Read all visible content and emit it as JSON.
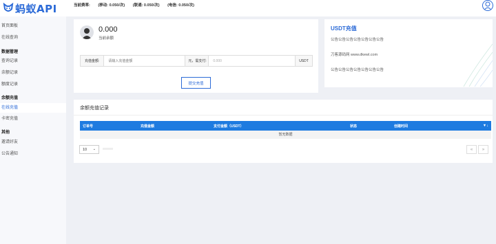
{
  "app": {
    "logo_text": "蚂蚁API"
  },
  "header": {
    "rates_label": "当前费率:",
    "rate_mobile": "(移动: 0.050/次)",
    "rate_unicom": "(联通: 0.050/次)",
    "rate_telecom": "(电信: 0.050/次)"
  },
  "sidebar": {
    "items": [
      {
        "label": "首页面板",
        "kind": "item"
      },
      {
        "label": "在线查询",
        "kind": "item"
      },
      {
        "label": "数据管理",
        "kind": "section"
      },
      {
        "label": "查询记录",
        "kind": "item"
      },
      {
        "label": "余额记录",
        "kind": "item"
      },
      {
        "label": "额度记录",
        "kind": "item"
      },
      {
        "label": "余额充值",
        "kind": "section"
      },
      {
        "label": "在线充值",
        "kind": "item",
        "active": true
      },
      {
        "label": "卡密充值",
        "kind": "item"
      },
      {
        "label": "其他",
        "kind": "section"
      },
      {
        "label": "邀请好友",
        "kind": "item"
      },
      {
        "label": "公告通知",
        "kind": "item"
      }
    ]
  },
  "balance": {
    "value": "0.000",
    "label": "当前余额"
  },
  "recharge_form": {
    "amount_label": "充值金额:",
    "amount_placeholder": "请输入充值金额",
    "pay_label": "元，需支付:",
    "pay_value": "0.000",
    "unit": "USDT",
    "submit_label": "提交充值"
  },
  "usdt_card": {
    "title": "USDT充值",
    "line1": "公告公告公告公告公告公告公告",
    "line2": "刀客源码网 www.dkewl.com",
    "line3": "公告公告公告公告公告公告公告"
  },
  "records": {
    "title": "余额充值记录",
    "columns": [
      "订单号",
      "充值金额",
      "支付金额（USDT）",
      "状态",
      "创建时间"
    ],
    "empty_text": "暂无数据",
    "page_size": "10",
    "prev": "«",
    "next": "»"
  },
  "colors": {
    "accent": "#2b6ad7",
    "table_header": "#1e7be0"
  }
}
